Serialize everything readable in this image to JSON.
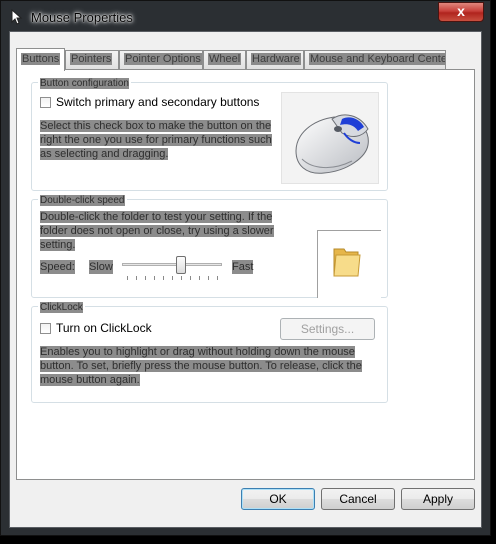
{
  "window": {
    "title": "Mouse Properties",
    "close_glyph": "x"
  },
  "tabs": [
    {
      "label": "Buttons",
      "active": true
    },
    {
      "label": "Pointers",
      "active": false
    },
    {
      "label": "Pointer Options",
      "active": false
    },
    {
      "label": "Wheel",
      "active": false
    },
    {
      "label": "Hardware",
      "active": false
    },
    {
      "label": "Mouse and Keyboard Center",
      "active": false
    }
  ],
  "button_config": {
    "title": "Button configuration",
    "switch_label": "Switch primary and secondary buttons",
    "switch_checked": false,
    "description_lines": [
      "Select this check box to make the button on the",
      "right the one you use for primary functions such",
      "as selecting and dragging."
    ],
    "image_icon": "mouse-icon"
  },
  "double_click": {
    "title": "Double-click speed",
    "description_lines": [
      "Double-click the folder to test your setting. If the",
      "folder does not open or close, try using a slower",
      "setting."
    ],
    "speed_label": "Speed:",
    "slow_label": "Slow",
    "fast_label": "Fast",
    "speed_value": 0.6,
    "folder_icon": "folder-icon"
  },
  "clicklock": {
    "title": "ClickLock",
    "checkbox_label": "Turn on ClickLock",
    "checked": false,
    "settings_label": "Settings...",
    "description_lines": [
      "Enables you to highlight or drag without holding down the mouse",
      "button. To set, briefly press the mouse button. To release, click the",
      "mouse button again."
    ]
  },
  "footer": {
    "ok_label": "OK",
    "cancel_label": "Cancel",
    "apply_label": "Apply"
  },
  "colors": {
    "close_button": "#c8403a",
    "redaction": "#8c8c8c",
    "default_button_border": "#3c7fb1"
  }
}
